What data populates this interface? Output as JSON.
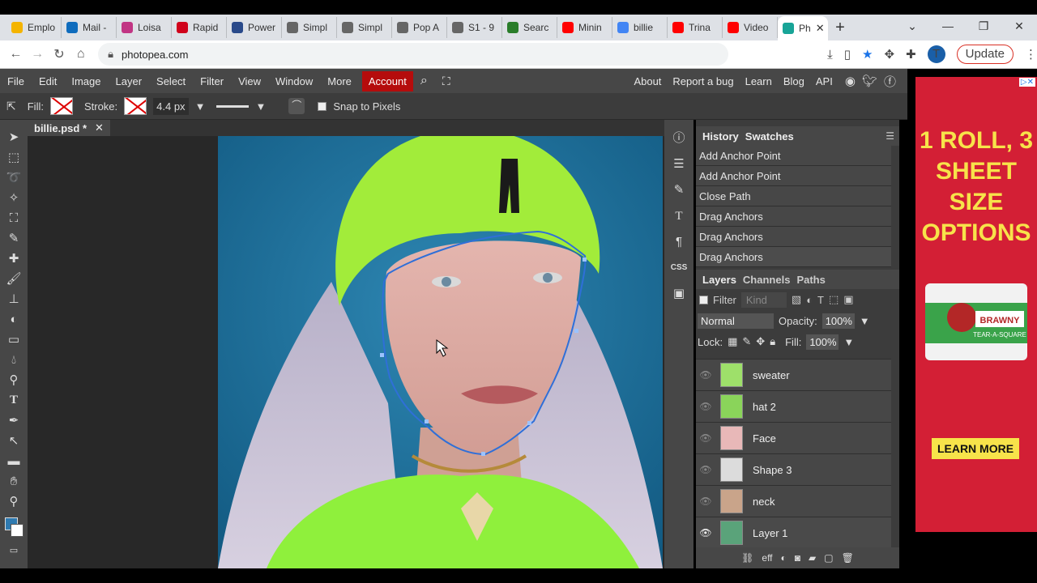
{
  "browser": {
    "tabs": [
      {
        "label": "Emplo",
        "color": "#f4b400"
      },
      {
        "label": "Mail -",
        "color": "#0f6cbd"
      },
      {
        "label": "Loisa",
        "color": "#c13584"
      },
      {
        "label": "Rapid",
        "color": "#d0021b"
      },
      {
        "label": "Power",
        "color": "#2a4a8a"
      },
      {
        "label": "Simpl",
        "color": "#666666"
      },
      {
        "label": "Simpl",
        "color": "#666666"
      },
      {
        "label": "Pop A",
        "color": "#666666"
      },
      {
        "label": "S1 - 9",
        "color": "#666666"
      },
      {
        "label": "Searc",
        "color": "#2a7d2a"
      },
      {
        "label": "Minin",
        "color": "#ff0000"
      },
      {
        "label": "billie",
        "color": "#4285f4"
      },
      {
        "label": "Trina",
        "color": "#ff0000"
      },
      {
        "label": "Video",
        "color": "#ff0000"
      }
    ],
    "active_tab": {
      "label": "Ph",
      "color": "#18a497"
    },
    "url": "photopea.com",
    "avatar_letter": "T",
    "update_label": "Update"
  },
  "menu": {
    "items": [
      "File",
      "Edit",
      "Image",
      "Layer",
      "Select",
      "Filter",
      "View",
      "Window",
      "More"
    ],
    "account": "Account",
    "right_items": [
      "About",
      "Report a bug",
      "Learn",
      "Blog",
      "API"
    ]
  },
  "options": {
    "fill_label": "Fill:",
    "stroke_label": "Stroke:",
    "stroke_width": "4.4 px",
    "snap_label": "Snap to Pixels"
  },
  "document": {
    "tab_title": "billie.psd *"
  },
  "history": {
    "tabs": [
      "History",
      "Swatches"
    ],
    "items": [
      "Add Anchor Point",
      "Add Anchor Point",
      "Close Path",
      "Drag Anchors",
      "Drag Anchors",
      "Drag Anchors"
    ]
  },
  "layers_panel": {
    "tabs": [
      "Layers",
      "Channels",
      "Paths"
    ],
    "filter_label": "Filter",
    "kind_label": "Kind",
    "blend_mode": "Normal",
    "opacity_label": "Opacity:",
    "opacity_value": "100%",
    "lock_label": "Lock:",
    "fill_label": "Fill:",
    "fill_value": "100%",
    "layers": [
      {
        "name": "sweater",
        "thumb": "#9ee06a",
        "visible": false
      },
      {
        "name": "hat 2",
        "thumb": "#8ad45a",
        "visible": false
      },
      {
        "name": "Face",
        "thumb": "#e8b8b8",
        "visible": false
      },
      {
        "name": "Shape 3",
        "thumb": "#dcdcdc",
        "visible": false
      },
      {
        "name": "neck",
        "thumb": "#c9a48a",
        "visible": false
      },
      {
        "name": "Layer 1",
        "thumb": "#5aa37a",
        "visible": true
      }
    ],
    "footer": "eff"
  },
  "ad": {
    "headline": "1 ROLL, 3 SHEET SIZE OPTIONS",
    "product": "BRAWNY",
    "product_sub": "TEAR-A-SQUARE",
    "cta": "LEARN MORE"
  }
}
